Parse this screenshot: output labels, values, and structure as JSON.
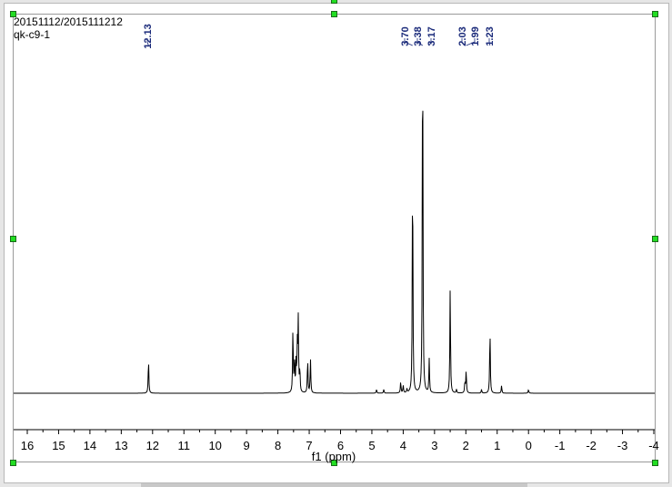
{
  "sample": {
    "line1": "20151112/2015111212",
    "line2": "qk-c9-1"
  },
  "colors": {
    "spectrum": "#000000",
    "peak_label": "#1a2a7a",
    "handle": "#22dd22"
  },
  "chart_data": {
    "type": "line",
    "title": "",
    "xlabel": "f1 (ppm)",
    "ylabel": "",
    "xlim": [
      16.5,
      -4
    ],
    "x_reversed": true,
    "grid": false,
    "ticks": [
      16,
      15,
      14,
      13,
      12,
      11,
      10,
      9,
      8,
      7,
      6,
      5,
      4,
      3,
      2,
      1,
      0,
      -1,
      -2,
      -3,
      -4
    ],
    "tick_labels": [
      "16",
      "15",
      "14",
      "13",
      "12",
      "11",
      "10",
      "9",
      "8",
      "7",
      "6",
      "5",
      "4",
      "3",
      "2",
      "1",
      "0",
      "-1",
      "-2",
      "-3",
      "-4"
    ],
    "peak_labels": [
      "12.13",
      "3.70",
      "3.38",
      "3.17",
      "2.03",
      "1.99",
      "1.23"
    ],
    "peak_label_positions": [
      12.13,
      3.7,
      3.38,
      3.17,
      2.03,
      1.99,
      1.23
    ],
    "peaks": [
      {
        "ppm": 12.13,
        "height": 0.09
      },
      {
        "ppm": 7.52,
        "height": 0.17
      },
      {
        "ppm": 7.47,
        "height": 0.08
      },
      {
        "ppm": 7.42,
        "height": 0.08
      },
      {
        "ppm": 7.38,
        "height": 0.12
      },
      {
        "ppm": 7.35,
        "height": 0.19
      },
      {
        "ppm": 7.3,
        "height": 0.06
      },
      {
        "ppm": 7.05,
        "height": 0.09
      },
      {
        "ppm": 6.96,
        "height": 0.09
      },
      {
        "ppm": 4.85,
        "height": 0.01
      },
      {
        "ppm": 4.62,
        "height": 0.01
      },
      {
        "ppm": 4.08,
        "height": 0.03
      },
      {
        "ppm": 4.0,
        "height": 0.02
      },
      {
        "ppm": 3.88,
        "height": 0.01
      },
      {
        "ppm": 3.7,
        "height": 0.62
      },
      {
        "ppm": 3.38,
        "height": 1.0
      },
      {
        "ppm": 3.17,
        "height": 0.09
      },
      {
        "ppm": 2.5,
        "height": 0.28
      },
      {
        "ppm": 2.3,
        "height": 0.01
      },
      {
        "ppm": 2.03,
        "height": 0.03
      },
      {
        "ppm": 1.99,
        "height": 0.06
      },
      {
        "ppm": 1.5,
        "height": 0.01
      },
      {
        "ppm": 1.23,
        "height": 0.17
      },
      {
        "ppm": 0.86,
        "height": 0.02
      },
      {
        "ppm": 0.0,
        "height": 0.01
      }
    ]
  }
}
